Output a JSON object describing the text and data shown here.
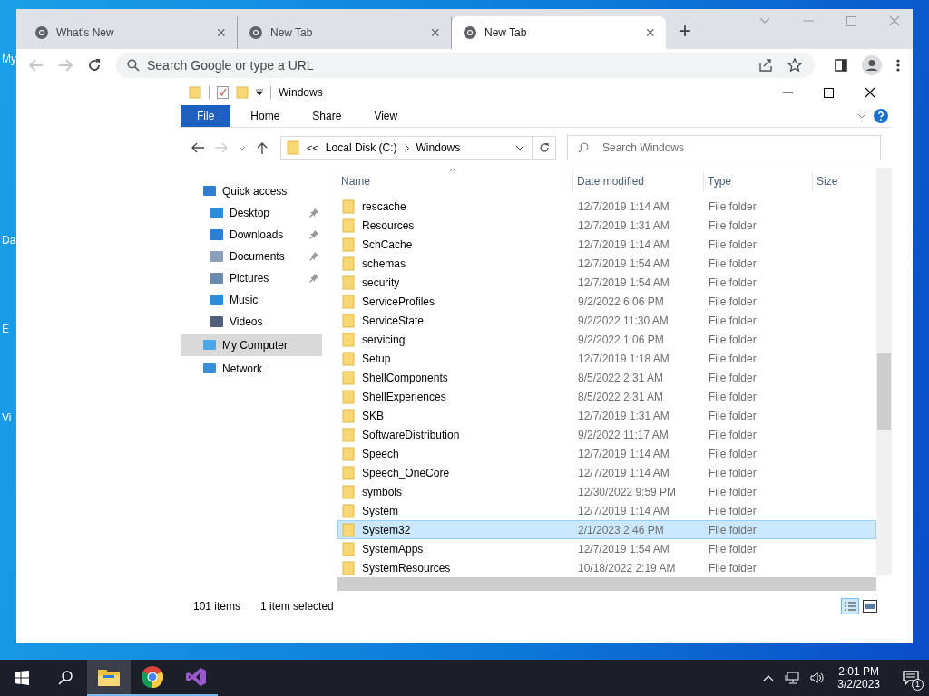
{
  "desktop": {
    "icon_labels": [
      "My",
      "Da",
      "E",
      "Vi"
    ]
  },
  "browser": {
    "tabs": [
      {
        "title": "What's New",
        "close": "×",
        "selected": false
      },
      {
        "title": "New Tab",
        "close": "×",
        "selected": false
      },
      {
        "title": "New Tab",
        "close": "×",
        "selected": true
      }
    ],
    "new_tab": "+",
    "omnibox": {
      "placeholder": "Search Google or type a URL"
    }
  },
  "explorer": {
    "title": "Windows",
    "ribbon_tabs": [
      {
        "label": "File",
        "selected": true
      },
      {
        "label": "Home",
        "selected": false
      },
      {
        "label": "Share",
        "selected": false
      },
      {
        "label": "View",
        "selected": false
      }
    ],
    "address": {
      "overflow": "<<",
      "segments": [
        "Local Disk (C:)",
        "Windows"
      ]
    },
    "search": {
      "placeholder": "Search Windows"
    },
    "nav": [
      {
        "label": "Quick access",
        "selected": false,
        "children": [
          {
            "label": "Desktop",
            "pinned": true,
            "selected": false
          },
          {
            "label": "Downloads",
            "pinned": true,
            "selected": false
          },
          {
            "label": "Documents",
            "pinned": true,
            "selected": false
          },
          {
            "label": "Pictures",
            "pinned": true,
            "selected": false
          },
          {
            "label": "Music",
            "pinned": false,
            "selected": false
          },
          {
            "label": "Videos",
            "pinned": false,
            "selected": false
          }
        ]
      },
      {
        "label": "My Computer",
        "selected": true
      },
      {
        "label": "Network",
        "selected": false
      }
    ],
    "columns": [
      "Name",
      "Date modified",
      "Type",
      "Size"
    ],
    "rows": [
      {
        "name": "rescache",
        "date": "12/7/2019 1:14 AM",
        "type": "File folder",
        "selected": false
      },
      {
        "name": "Resources",
        "date": "12/7/2019 1:31 AM",
        "type": "File folder",
        "selected": false
      },
      {
        "name": "SchCache",
        "date": "12/7/2019 1:14 AM",
        "type": "File folder",
        "selected": false
      },
      {
        "name": "schemas",
        "date": "12/7/2019 1:54 AM",
        "type": "File folder",
        "selected": false
      },
      {
        "name": "security",
        "date": "12/7/2019 1:54 AM",
        "type": "File folder",
        "selected": false
      },
      {
        "name": "ServiceProfiles",
        "date": "9/2/2022 6:06 PM",
        "type": "File folder",
        "selected": false
      },
      {
        "name": "ServiceState",
        "date": "9/2/2022 11:30 AM",
        "type": "File folder",
        "selected": false
      },
      {
        "name": "servicing",
        "date": "9/2/2022 1:06 PM",
        "type": "File folder",
        "selected": false
      },
      {
        "name": "Setup",
        "date": "12/7/2019 1:18 AM",
        "type": "File folder",
        "selected": false
      },
      {
        "name": "ShellComponents",
        "date": "8/5/2022 2:31 AM",
        "type": "File folder",
        "selected": false
      },
      {
        "name": "ShellExperiences",
        "date": "8/5/2022 2:31 AM",
        "type": "File folder",
        "selected": false
      },
      {
        "name": "SKB",
        "date": "12/7/2019 1:31 AM",
        "type": "File folder",
        "selected": false
      },
      {
        "name": "SoftwareDistribution",
        "date": "9/2/2022 11:17 AM",
        "type": "File folder",
        "selected": false
      },
      {
        "name": "Speech",
        "date": "12/7/2019 1:14 AM",
        "type": "File folder",
        "selected": false
      },
      {
        "name": "Speech_OneCore",
        "date": "12/7/2019 1:14 AM",
        "type": "File folder",
        "selected": false
      },
      {
        "name": "symbols",
        "date": "12/30/2022 9:59 PM",
        "type": "File folder",
        "selected": false
      },
      {
        "name": "System",
        "date": "12/7/2019 1:14 AM",
        "type": "File folder",
        "selected": false
      },
      {
        "name": "System32",
        "date": "2/1/2023 2:46 PM",
        "type": "File folder",
        "selected": true
      },
      {
        "name": "SystemApps",
        "date": "12/7/2019 1:54 AM",
        "type": "File folder",
        "selected": false
      },
      {
        "name": "SystemResources",
        "date": "10/18/2022 2:19 AM",
        "type": "File folder",
        "selected": false
      }
    ],
    "status": {
      "item_count": "101 items",
      "selection": "1 item selected"
    }
  },
  "taskbar": {
    "apps": [
      {
        "kind": "explorer",
        "selected": true
      },
      {
        "kind": "chrome",
        "selected": false
      },
      {
        "kind": "studio",
        "selected": false
      }
    ],
    "time": "2:01 PM",
    "date": "3/2/2023",
    "notification_count": "1"
  }
}
